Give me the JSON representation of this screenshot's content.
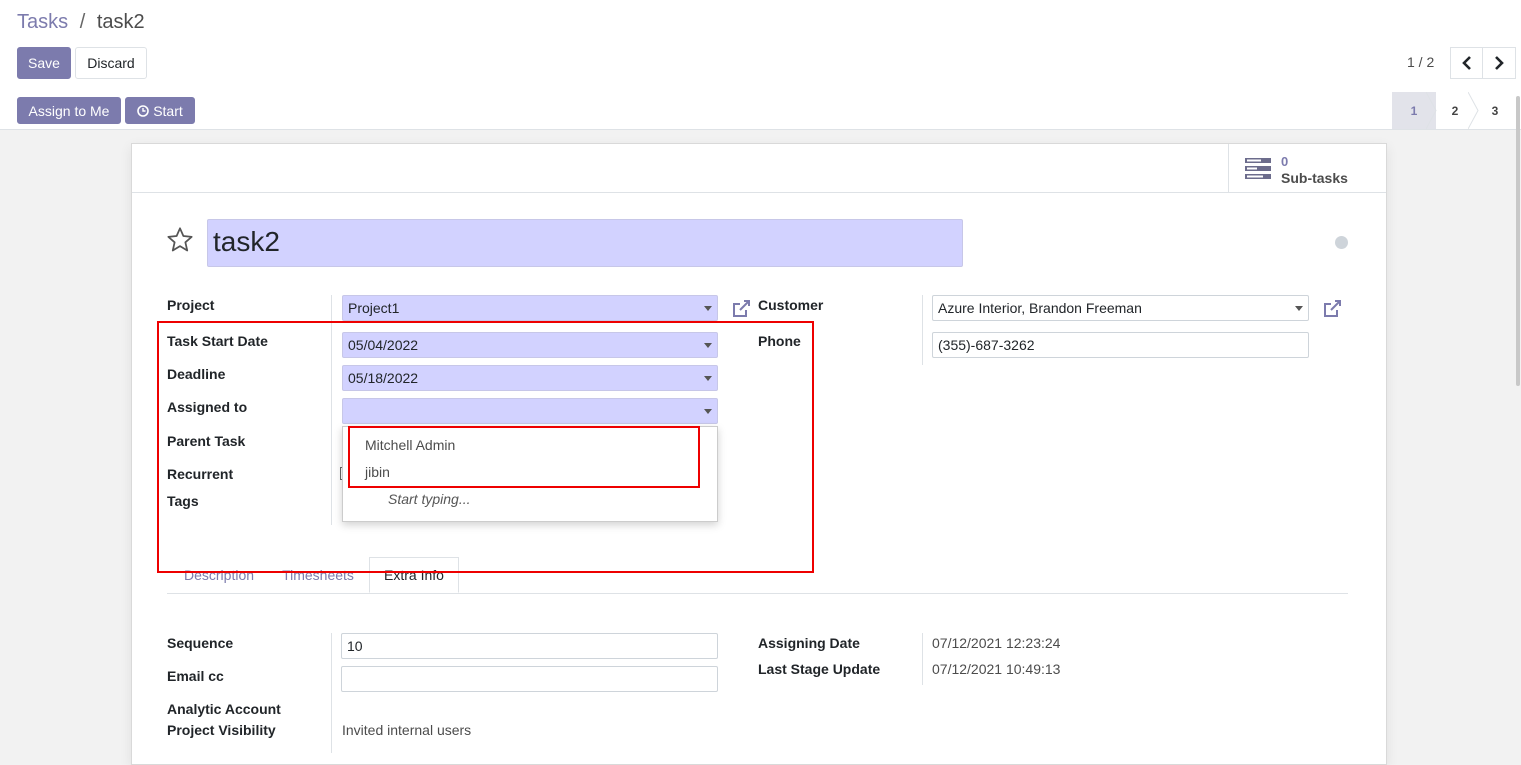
{
  "breadcrumb": {
    "parent": "Tasks",
    "separator": "/",
    "current": "task2"
  },
  "toolbar": {
    "save_label": "Save",
    "discard_label": "Discard"
  },
  "pager": {
    "value": "1 / 2",
    "prev_icon": "chevron-left-icon",
    "next_icon": "chevron-right-icon"
  },
  "header_buttons": {
    "assign_label": "Assign to Me",
    "start_label": "Start",
    "start_icon": "clock-icon"
  },
  "stages": [
    "1",
    "2",
    "3"
  ],
  "active_stage": "1",
  "smart_button": {
    "value": "0",
    "label": "Sub-tasks",
    "icon": "tasks-list-icon"
  },
  "task": {
    "name": "task2",
    "priority_icon": "star-icon",
    "kanban_state_icon": "status-dot-icon"
  },
  "left_fields": {
    "project": {
      "label": "Project",
      "value": "Project1"
    },
    "task_start_date": {
      "label": "Task Start Date",
      "value": "05/04/2022"
    },
    "deadline": {
      "label": "Deadline",
      "value": "05/18/2022"
    },
    "assigned_to": {
      "label": "Assigned to",
      "value": ""
    },
    "parent_task": {
      "label": "Parent Task"
    },
    "recurrent": {
      "label": "Recurrent"
    },
    "tags": {
      "label": "Tags"
    }
  },
  "right_fields": {
    "customer": {
      "label": "Customer",
      "value": "Azure Interior, Brandon Freeman"
    },
    "phone": {
      "label": "Phone",
      "value": "(355)-687-3262"
    }
  },
  "assigned_dropdown": {
    "options": [
      "Mitchell Admin",
      "jibin"
    ],
    "hint": "Start typing..."
  },
  "tabs": [
    "Description",
    "Timesheets",
    "Extra Info"
  ],
  "active_tab": "Extra Info",
  "extra_info": {
    "sequence": {
      "label": "Sequence",
      "value": "10"
    },
    "email_cc": {
      "label": "Email cc",
      "value": ""
    },
    "analytic_account": {
      "label": "Analytic Account"
    },
    "project_visibility": {
      "label": "Project Visibility",
      "value": "Invited internal users"
    },
    "assigning_date": {
      "label": "Assigning Date",
      "value": "07/12/2021 12:23:24"
    },
    "last_stage_update": {
      "label": "Last Stage Update",
      "value": "07/12/2021 10:49:13"
    }
  },
  "colors": {
    "primary": "#7c7bad",
    "required_field": "#d2d2ff",
    "highlight": "#ee0000"
  }
}
